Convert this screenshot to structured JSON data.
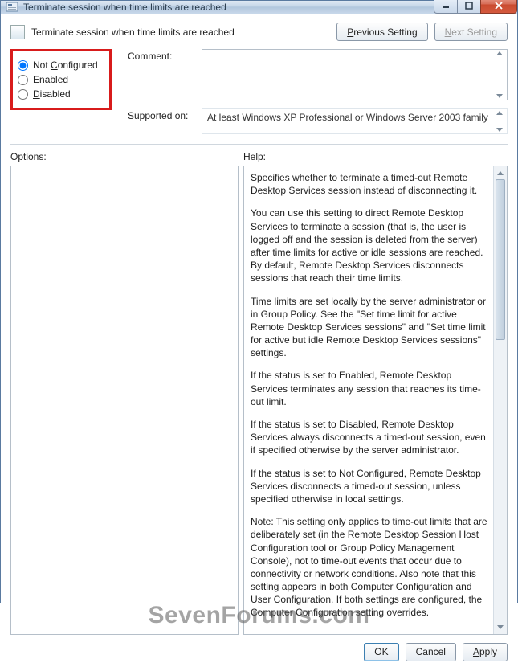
{
  "window": {
    "title": "Terminate session when time limits are reached"
  },
  "header": {
    "title": "Terminate session when time limits are reached",
    "previous_setting": "Previous Setting",
    "next_setting": "Next Setting"
  },
  "radios": {
    "not_configured": "Not Configured",
    "enabled": "Enabled",
    "disabled": "Disabled",
    "selected": "not_configured"
  },
  "fields": {
    "comment_label": "Comment:",
    "comment_value": "",
    "supported_label": "Supported on:",
    "supported_value": "At least Windows XP Professional or Windows Server 2003 family"
  },
  "panels": {
    "options_label": "Options:",
    "help_label": "Help:"
  },
  "help_paragraphs": [
    "Specifies whether to terminate a timed-out Remote Desktop Services session instead of disconnecting it.",
    "You can use this setting to direct Remote Desktop Services to terminate a session (that is, the user is logged off and the session is deleted from the server) after time limits for active or idle sessions are reached. By default, Remote Desktop Services disconnects sessions that reach their time limits.",
    "Time limits are set locally by the server administrator or in Group Policy. See the \"Set time limit for active Remote Desktop Services sessions\" and \"Set time limit for active but idle Remote Desktop Services sessions\" settings.",
    "If the status is set to Enabled, Remote Desktop Services terminates any session that reaches its time-out limit.",
    "If the status is set to Disabled, Remote Desktop Services always disconnects a timed-out session, even if specified otherwise by the server administrator.",
    "If the status is set to Not Configured, Remote Desktop Services disconnects a timed-out session, unless specified otherwise in local settings.",
    "Note: This setting only applies to time-out limits that are deliberately set (in the Remote Desktop Session Host Configuration tool or Group Policy Management Console), not to time-out events that occur due to connectivity or network conditions. Also note that this setting appears in both Computer Configuration and User Configuration. If both settings are configured, the Computer Configuration setting overrides."
  ],
  "footer": {
    "ok": "OK",
    "cancel": "Cancel",
    "apply": "Apply"
  },
  "watermark": "SevenForums.com"
}
